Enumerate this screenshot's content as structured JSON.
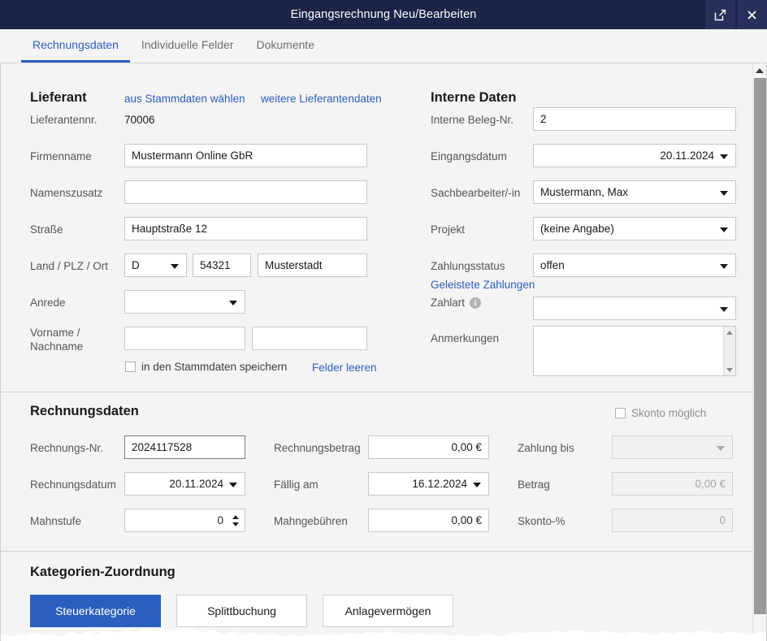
{
  "window": {
    "title": "Eingangsrechnung Neu/Bearbeiten",
    "popout_icon": "open-in-new-window-icon",
    "close_icon": "close-icon",
    "titlebar_color": "#1b2447",
    "accent_color": "#2b5fbd"
  },
  "tabs": [
    {
      "label": "Rechnungsdaten",
      "active": true
    },
    {
      "label": "Individuelle Felder",
      "active": false
    },
    {
      "label": "Dokumente",
      "active": false
    }
  ],
  "supplier": {
    "heading": "Lieferant",
    "link_choose": "aus Stammdaten wählen",
    "link_more": "weitere Lieferantendaten",
    "fields": {
      "supplier_no_label": "Lieferantennr.",
      "supplier_no_value": "70006",
      "company_label": "Firmenname",
      "company_value": "Mustermann Online GbR",
      "name_addon_label": "Namenszusatz",
      "name_addon_value": "",
      "street_label": "Straße",
      "street_value": "Hauptstraße 12",
      "country_zip_city_label": "Land / PLZ / Ort",
      "country_value": "D",
      "zip_value": "54321",
      "city_value": "Musterstadt",
      "salutation_label": "Anrede",
      "salutation_value": "",
      "firstname_lastname_label": "Vorname / Nachname",
      "firstname_value": "",
      "lastname_value": ""
    },
    "save_master_checkbox_label": "in den Stammdaten speichern",
    "save_master_checked": false,
    "clear_fields_link": "Felder leeren"
  },
  "internal": {
    "heading": "Interne Daten",
    "fields": {
      "internal_doc_no_label": "Interne Beleg-Nr.",
      "internal_doc_no_value": "2",
      "receipt_date_label": "Eingangsdatum",
      "receipt_date_value": "20.11.2024",
      "clerk_label": "Sachbearbeiter/-in",
      "clerk_value": "Mustermann, Max",
      "project_label": "Projekt",
      "project_value": "(keine Angabe)",
      "payment_status_label": "Zahlungsstatus",
      "payment_status_value": "offen",
      "payments_made_link": "Geleistete Zahlungen",
      "payment_type_label": "Zahlart",
      "payment_type_info_icon": "info-icon",
      "payment_type_value": "",
      "notes_label": "Anmerkungen",
      "notes_value": ""
    }
  },
  "invoice": {
    "heading": "Rechnungsdaten",
    "skonto_checkbox_label": "Skonto möglich",
    "skonto_checked": false,
    "fields": {
      "invoice_no_label": "Rechnungs-Nr.",
      "invoice_no_value": "2024117528",
      "invoice_date_label": "Rechnungsdatum",
      "invoice_date_value": "20.11.2024",
      "dunning_level_label": "Mahnstufe",
      "dunning_level_value": "0",
      "invoice_amount_label": "Rechnungsbetrag",
      "invoice_amount_value": "0,00 €",
      "due_on_label": "Fällig am",
      "due_on_value": "16.12.2024",
      "dunning_fees_label": "Mahngebühren",
      "dunning_fees_value": "0,00 €",
      "payment_until_label": "Zahlung bis",
      "payment_until_value": "",
      "skonto_amount_label": "Betrag",
      "skonto_amount_value": "0,00 €",
      "skonto_percent_label": "Skonto-%",
      "skonto_percent_value": "0"
    }
  },
  "categories": {
    "heading": "Kategorien-Zuordnung",
    "tabs": [
      {
        "label": "Steuerkategorie",
        "active": true
      },
      {
        "label": "Splittbuchung",
        "active": false
      },
      {
        "label": "Anlagevermögen",
        "active": false
      }
    ]
  },
  "scrollbar": {
    "up_arrow_icon": "scroll-up-arrow-icon"
  }
}
